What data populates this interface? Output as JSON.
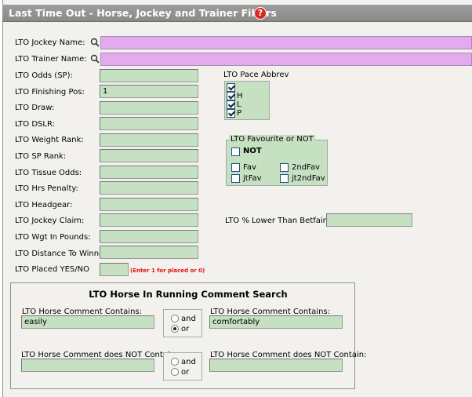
{
  "panel": {
    "title": "Last Time Out - Horse, Jockey and Trainer Filters",
    "help_icon_glyph": "?"
  },
  "fields": {
    "jockey_name": {
      "label": "LTO Jockey Name:",
      "value": ""
    },
    "trainer_name": {
      "label": "LTO Trainer Name:",
      "value": ""
    },
    "odds_sp": {
      "label": "LTO Odds (SP):",
      "value": ""
    },
    "finishing_pos": {
      "label": "LTO Finishing Pos:",
      "value": "1"
    },
    "draw": {
      "label": "LTO Draw:",
      "value": ""
    },
    "dslr": {
      "label": "LTO DSLR:",
      "value": ""
    },
    "weight_rank": {
      "label": "LTO Weight Rank:",
      "value": ""
    },
    "sp_rank": {
      "label": "LTO SP Rank:",
      "value": ""
    },
    "tissue_odds": {
      "label": "LTO Tissue Odds:",
      "value": ""
    },
    "hrs_penalty": {
      "label": "LTO Hrs Penalty:",
      "value": ""
    },
    "headgear": {
      "label": "LTO Headgear:",
      "value": ""
    },
    "jockey_claim": {
      "label": "LTO Jockey Claim:",
      "value": ""
    },
    "wgt_in_pounds": {
      "label": "LTO Wgt In Pounds:",
      "value": ""
    },
    "distance_to_winner": {
      "label": "LTO Distance To Winner:",
      "value": ""
    },
    "placed_yes_no": {
      "label": "LTO Placed YES/NO",
      "value": "",
      "hint": "(Enter 1 for placed or 0)"
    }
  },
  "pace_abbrev": {
    "label": "LTO Pace Abbrev",
    "items": [
      {
        "label": "",
        "checked": true
      },
      {
        "label": "H",
        "checked": true
      },
      {
        "label": "L",
        "checked": true
      },
      {
        "label": "P",
        "checked": true
      }
    ]
  },
  "favourite": {
    "legend": "LTO Favourite or NOT",
    "not_label": "NOT",
    "not_checked": false,
    "fav_label": "Fav",
    "second_fav_label": "2ndFav",
    "jt_fav_label": "jtFav",
    "jt_second_fav_label": "jt2ndFav"
  },
  "betfair": {
    "label": "LTO % Lower Than Betfair SP:",
    "value": ""
  },
  "comment_search": {
    "title": "LTO Horse In Running Comment Search",
    "contains_label_1": "LTO Horse Comment Contains:",
    "contains_value_1": "easily",
    "contains_label_2": "LTO Horse Comment Contains:",
    "contains_value_2": "comfortably",
    "contains_and": "and",
    "contains_or": "or",
    "contains_selected": "or",
    "not_contain_label_1": "LTO Horse Comment does NOT Contain:",
    "not_contain_value_1": "",
    "not_contain_label_2": "LTO Horse Comment does NOT Contain:",
    "not_contain_value_2": "",
    "not_and": "and",
    "not_or": "or",
    "not_selected": "none"
  },
  "colors": {
    "field_green": "#c6e0c2",
    "field_pink": "#e3aaf0",
    "title_bar": "#939393",
    "help_red": "#d42a1f",
    "hint_red": "#e3140d"
  },
  "icons": {
    "search": "magnifier-icon",
    "help": "help-icon"
  }
}
